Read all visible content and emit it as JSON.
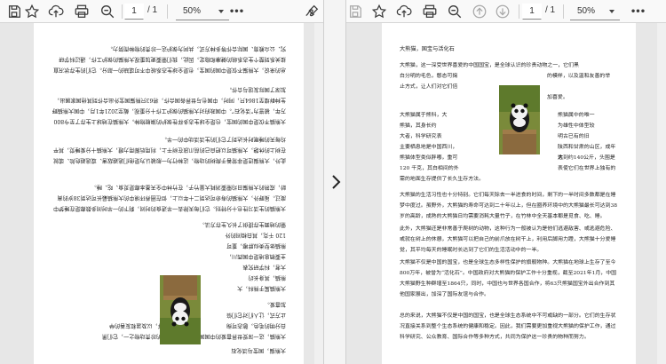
{
  "viewer": {
    "page_current": "1",
    "page_total": "/ 1",
    "zoom": "50%",
    "more": "•••"
  },
  "icons": [
    "save-icon",
    "bookmark-star-icon",
    "upload-icon",
    "print-icon",
    "zoom-out-icon",
    "page-up-icon",
    "page-down-icon",
    "more-icon",
    "sign-icon",
    "chevron-right-icon"
  ],
  "document": {
    "title": "大熊猫，国宝与活化石",
    "p1a": "大熊猫，这一深受世界喜爱的中国国宝，是全球认识的珍贵动物之一，它们黑",
    "p1b": "白分明的毛色，憨态可掬",
    "p1c": "的模样，以及温和友善的举",
    "p1d": "止方式，让人们对它们倍",
    "p1e": "加喜爱。",
    "p2a": "大熊猫属于熊科，大",
    "p2a2": "熊猫属中的唯一",
    "p2b": "熊猫，其身长约",
    "p2b2": "为雄性中体型较",
    "p2c": "大者，科学研究表",
    "p2c2": "明古已有的旧",
    "p2d": "主要栖息地是中国西川，",
    "p2d2": "陕西和甘肃的山区，成年大",
    "p2e": "熊猫体型类似胖嘟，重可",
    "p2e2": "达到约140公斤，头围是",
    "p2f": "120 千克，其白相间的外",
    "p2f2": "表使它们在世界上独有的",
    "p2g": "需的地面生存提供了长久生存方法。",
    "p3": "大熊猫的生活习性也十分特别。它们每天除去一半进食的时间，剩下的一半时间多数都是在睡梦中度过。虽野外，大熊猫的寿命可达到二十年以上，但在圈养环境中的大熊猫最长可达到38岁的高龄，成熟的大熊猫日均需要消耗大量竹子，在竹林中全天基本都是觅食、吃、睡。",
    "p4": "此外，大熊猫还是非常善于爬树的动物，这种行为一般被认为是他们逃避敌害、或逃避危险、或就在树上的休憩，大熊猫可以把自己的前爪放在树干上，利用后脚用力蹬，大熊猫十分爱睡觉，其平均每天的睡眠时长达到了它们的生活活动中的一半。",
    "p5": "大熊猫不仅是中国的国宝，也是全球生态多样性保护的旗舰物种。大熊猫在地球上生存了至今800万年，被誉为“活化石”。中国政府对大熊猫的保护工作十分重视，截至2021年1月，中国大熊猫野生种群增至1864只，同时，中国也与世界各国合作，将63只熊猫国宝外出合作到其他国家展出，加深了国际友谊与合作。",
    "p6": "总的来说，大熊猫不仅是中国的国宝，也是全球生态系统中不可或缺的一部分。它们的生存状况直接关系到整个生态系统的健康和稳定。因此，我们需要更加重视大熊猫的保护工作，通过科学研究、公众教育、国际合作等多种方式，共同为保护这一珍贵的物种而努力。"
  },
  "colors": {
    "toolbar_bg": "#f9f9f9",
    "page_bg": "#ffffff",
    "viewer_bg": "#e7e7e7",
    "text": "#222222"
  }
}
